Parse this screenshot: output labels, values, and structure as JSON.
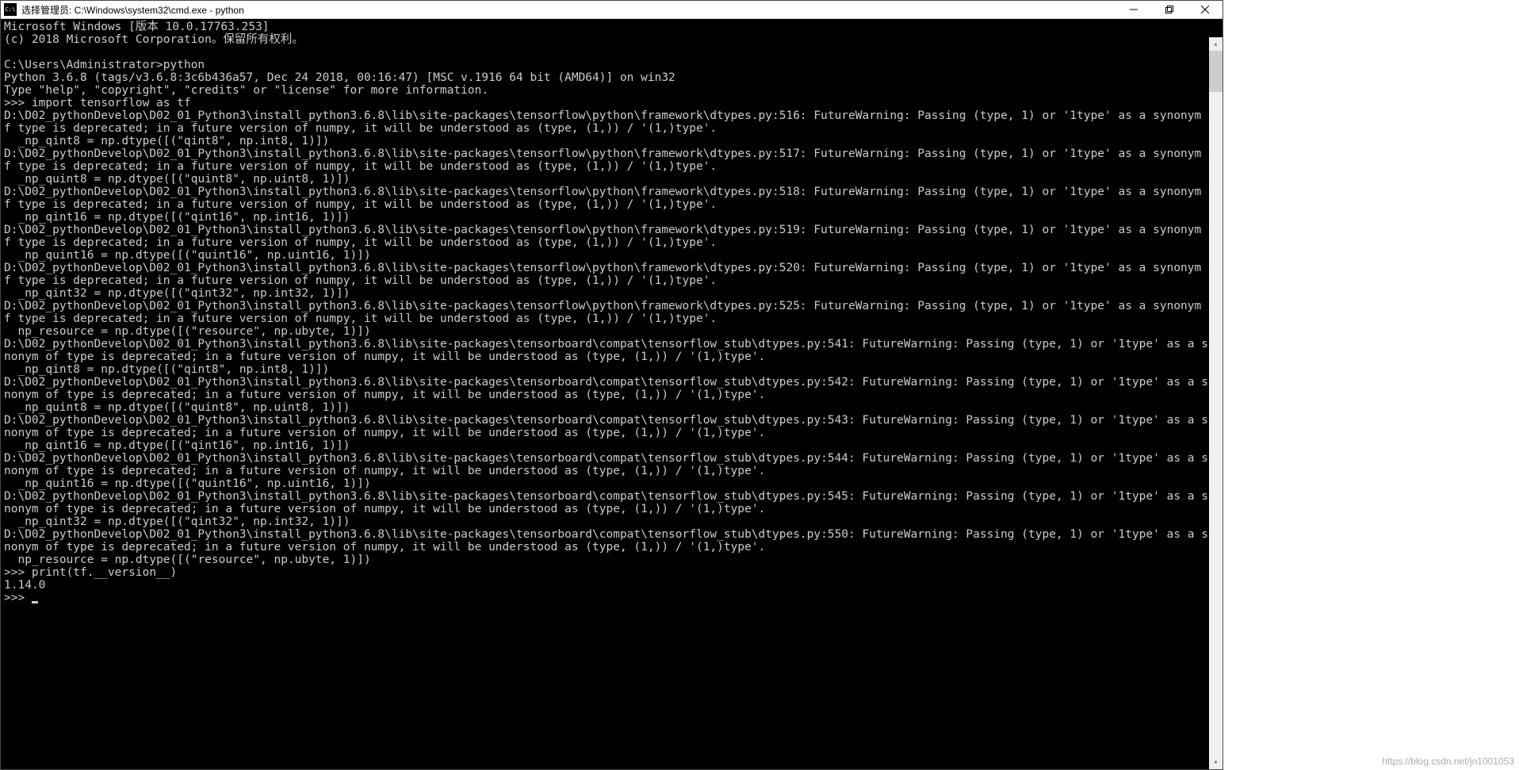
{
  "window": {
    "title": "选择管理员: C:\\Windows\\system32\\cmd.exe - python"
  },
  "terminal": {
    "lines": [
      "Microsoft Windows [版本 10.0.17763.253]",
      "(c) 2018 Microsoft Corporation。保留所有权利。",
      "",
      "C:\\Users\\Administrator>python",
      "Python 3.6.8 (tags/v3.6.8:3c6b436a57, Dec 24 2018, 00:16:47) [MSC v.1916 64 bit (AMD64)] on win32",
      "Type \"help\", \"copyright\", \"credits\" or \"license\" for more information.",
      ">>> import tensorflow as tf",
      "D:\\D02_pythonDevelop\\D02_01_Python3\\install_python3.6.8\\lib\\site-packages\\tensorflow\\python\\framework\\dtypes.py:516: FutureWarning: Passing (type, 1) or '1type' as a synonym of type is deprecated; in a future version of numpy, it will be understood as (type, (1,)) / '(1,)type'.",
      "  _np_qint8 = np.dtype([(\"qint8\", np.int8, 1)])",
      "D:\\D02_pythonDevelop\\D02_01_Python3\\install_python3.6.8\\lib\\site-packages\\tensorflow\\python\\framework\\dtypes.py:517: FutureWarning: Passing (type, 1) or '1type' as a synonym of type is deprecated; in a future version of numpy, it will be understood as (type, (1,)) / '(1,)type'.",
      "  _np_quint8 = np.dtype([(\"quint8\", np.uint8, 1)])",
      "D:\\D02_pythonDevelop\\D02_01_Python3\\install_python3.6.8\\lib\\site-packages\\tensorflow\\python\\framework\\dtypes.py:518: FutureWarning: Passing (type, 1) or '1type' as a synonym of type is deprecated; in a future version of numpy, it will be understood as (type, (1,)) / '(1,)type'.",
      "  _np_qint16 = np.dtype([(\"qint16\", np.int16, 1)])",
      "D:\\D02_pythonDevelop\\D02_01_Python3\\install_python3.6.8\\lib\\site-packages\\tensorflow\\python\\framework\\dtypes.py:519: FutureWarning: Passing (type, 1) or '1type' as a synonym of type is deprecated; in a future version of numpy, it will be understood as (type, (1,)) / '(1,)type'.",
      "  _np_quint16 = np.dtype([(\"quint16\", np.uint16, 1)])",
      "D:\\D02_pythonDevelop\\D02_01_Python3\\install_python3.6.8\\lib\\site-packages\\tensorflow\\python\\framework\\dtypes.py:520: FutureWarning: Passing (type, 1) or '1type' as a synonym of type is deprecated; in a future version of numpy, it will be understood as (type, (1,)) / '(1,)type'.",
      "  _np_qint32 = np.dtype([(\"qint32\", np.int32, 1)])",
      "D:\\D02_pythonDevelop\\D02_01_Python3\\install_python3.6.8\\lib\\site-packages\\tensorflow\\python\\framework\\dtypes.py:525: FutureWarning: Passing (type, 1) or '1type' as a synonym of type is deprecated; in a future version of numpy, it will be understood as (type, (1,)) / '(1,)type'.",
      "  np_resource = np.dtype([(\"resource\", np.ubyte, 1)])",
      "D:\\D02_pythonDevelop\\D02_01_Python3\\install_python3.6.8\\lib\\site-packages\\tensorboard\\compat\\tensorflow_stub\\dtypes.py:541: FutureWarning: Passing (type, 1) or '1type' as a synonym of type is deprecated; in a future version of numpy, it will be understood as (type, (1,)) / '(1,)type'.",
      "  _np_qint8 = np.dtype([(\"qint8\", np.int8, 1)])",
      "D:\\D02_pythonDevelop\\D02_01_Python3\\install_python3.6.8\\lib\\site-packages\\tensorboard\\compat\\tensorflow_stub\\dtypes.py:542: FutureWarning: Passing (type, 1) or '1type' as a synonym of type is deprecated; in a future version of numpy, it will be understood as (type, (1,)) / '(1,)type'.",
      "  _np_quint8 = np.dtype([(\"quint8\", np.uint8, 1)])",
      "D:\\D02_pythonDevelop\\D02_01_Python3\\install_python3.6.8\\lib\\site-packages\\tensorboard\\compat\\tensorflow_stub\\dtypes.py:543: FutureWarning: Passing (type, 1) or '1type' as a synonym of type is deprecated; in a future version of numpy, it will be understood as (type, (1,)) / '(1,)type'.",
      "  _np_qint16 = np.dtype([(\"qint16\", np.int16, 1)])",
      "D:\\D02_pythonDevelop\\D02_01_Python3\\install_python3.6.8\\lib\\site-packages\\tensorboard\\compat\\tensorflow_stub\\dtypes.py:544: FutureWarning: Passing (type, 1) or '1type' as a synonym of type is deprecated; in a future version of numpy, it will be understood as (type, (1,)) / '(1,)type'.",
      "  _np_quint16 = np.dtype([(\"quint16\", np.uint16, 1)])",
      "D:\\D02_pythonDevelop\\D02_01_Python3\\install_python3.6.8\\lib\\site-packages\\tensorboard\\compat\\tensorflow_stub\\dtypes.py:545: FutureWarning: Passing (type, 1) or '1type' as a synonym of type is deprecated; in a future version of numpy, it will be understood as (type, (1,)) / '(1,)type'.",
      "  _np_qint32 = np.dtype([(\"qint32\", np.int32, 1)])",
      "D:\\D02_pythonDevelop\\D02_01_Python3\\install_python3.6.8\\lib\\site-packages\\tensorboard\\compat\\tensorflow_stub\\dtypes.py:550: FutureWarning: Passing (type, 1) or '1type' as a synonym of type is deprecated; in a future version of numpy, it will be understood as (type, (1,)) / '(1,)type'.",
      "  np_resource = np.dtype([(\"resource\", np.ubyte, 1)])",
      ">>> print(tf.__version__)",
      "1.14.0",
      ">>> "
    ]
  },
  "watermark": "https://blog.csdn.net/jn1001053"
}
